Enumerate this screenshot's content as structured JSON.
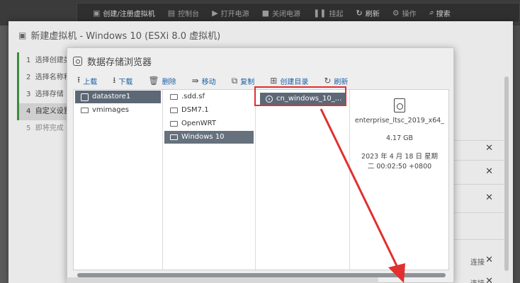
{
  "topbar": {
    "items": [
      {
        "icon": "create-icon",
        "label": "创建/注册虚拟机"
      },
      {
        "icon": "console-icon",
        "label": "控制台"
      },
      {
        "icon": "power-on-icon",
        "label": "打开电源"
      },
      {
        "icon": "power-off-icon",
        "label": "关闭电源"
      },
      {
        "icon": "pause-icon",
        "label": "挂起"
      },
      {
        "icon": "refresh-icon",
        "label": "刷新"
      },
      {
        "icon": "gear-icon",
        "label": "操作"
      },
      {
        "icon": "search-icon",
        "label": "搜索"
      }
    ]
  },
  "wizard": {
    "title": "新建虚拟机 - Windows 10 (ESXi 8.0 虚拟机)",
    "steps": [
      {
        "num": "1",
        "label": "选择创建类型"
      },
      {
        "num": "2",
        "label": "选择名称和客户机操作系统"
      },
      {
        "num": "3",
        "label": "选择存储"
      },
      {
        "num": "4",
        "label": "自定义设置"
      },
      {
        "num": "5",
        "label": "即将完成"
      }
    ],
    "right_labels": [
      "连接",
      "连接"
    ]
  },
  "browser": {
    "title": "数据存储浏览器",
    "toolbar": {
      "upload": "上载",
      "download": "下载",
      "delete": "删除",
      "move": "移动",
      "copy": "复制",
      "mkdir": "创建目录",
      "refresh": "刷新"
    },
    "datastores": [
      "datastore1",
      "vmimages"
    ],
    "folders": [
      ".sdd.sf",
      "DSM7.1",
      "OpenWRT",
      "Windows 10"
    ],
    "files": [
      "cn_windows_10_..."
    ],
    "details": {
      "name": "enterprise_ltsc_2019_x64_",
      "size": "4.17 GB",
      "date_line1": "2023 年 4 月 18 日 星期",
      "date_line2": "二 00:02:50 +0800"
    }
  },
  "colors": {
    "highlight": "#e0302f",
    "selection": "#5d6876",
    "link": "#1b5fa3"
  }
}
